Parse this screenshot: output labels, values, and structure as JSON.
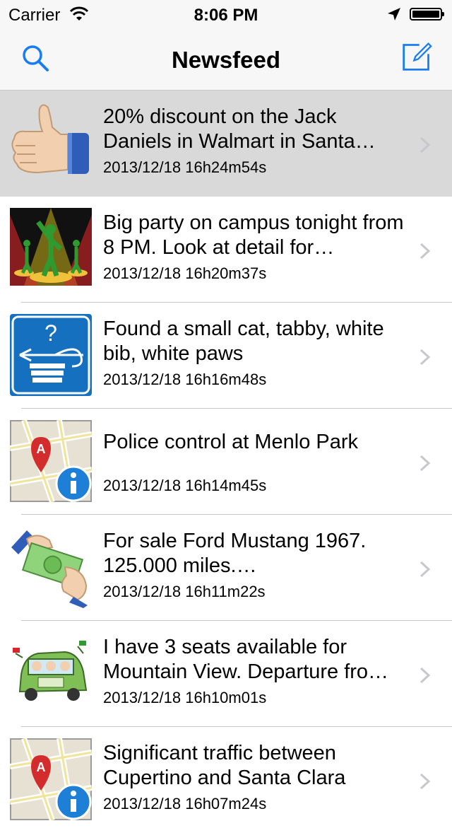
{
  "status_bar": {
    "carrier": "Carrier",
    "time": "8:06 PM"
  },
  "nav": {
    "title": "Newsfeed",
    "left_icon": "search-icon",
    "right_icon": "compose-icon",
    "accent": "#1a7cf5"
  },
  "feed": [
    {
      "title": "20% discount on the Jack Daniels in Walmart in Santa…",
      "date": "2013/12/18 16h24m54s",
      "icon": "thumbs-up-icon",
      "selected": true
    },
    {
      "title": "Big party on campus tonight from 8 PM. Look at detail for…",
      "date": "2013/12/18 16h20m37s",
      "icon": "party-icon"
    },
    {
      "title": "Found a small cat, tabby, white bib, white paws",
      "date": "2013/12/18 16h16m48s",
      "icon": "lost-found-icon"
    },
    {
      "title": "Police control at Menlo Park",
      "date": "2013/12/18 16h14m45s",
      "icon": "map-info-icon"
    },
    {
      "title": "For sale Ford Mustang 1967. 125.000 miles.…",
      "date": "2013/12/18 16h11m22s",
      "icon": "money-hand-icon"
    },
    {
      "title": "I have 3 seats available for Mountain View. Departure fro…",
      "date": "2013/12/18 16h10m01s",
      "icon": "carpool-icon"
    },
    {
      "title": "Significant traffic between Cupertino and Santa Clara",
      "date": "2013/12/18 16h07m24s",
      "icon": "map-info-icon"
    }
  ]
}
